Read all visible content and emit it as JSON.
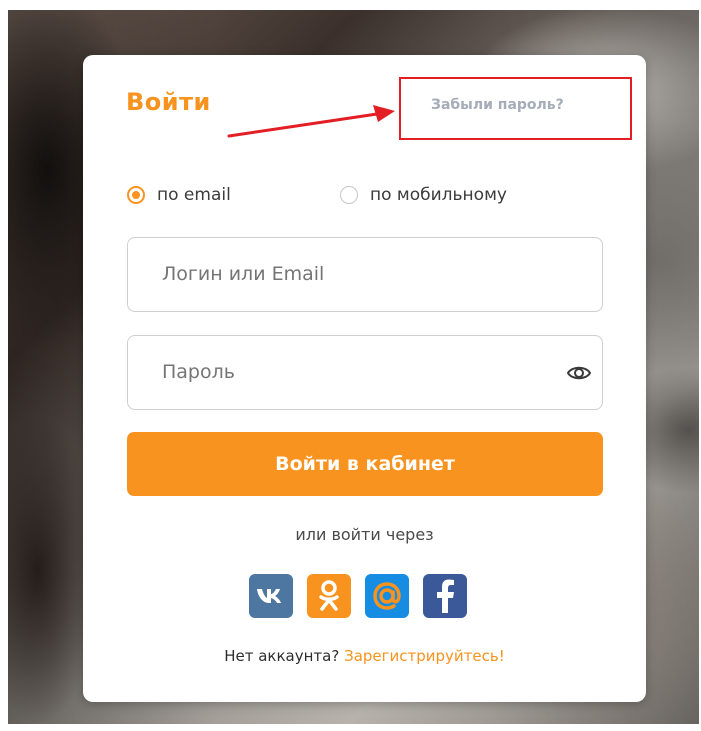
{
  "login": {
    "title": "Войти",
    "forgot_password": "Забыли пароль?",
    "method_email": "по email",
    "method_mobile": "по мобильному",
    "selected_method": "email",
    "login_placeholder": "Логин или Email",
    "password_placeholder": "Пароль",
    "submit_label": "Войти в кабинет",
    "social_caption": "или войти через",
    "no_account": "Нет аккаунта?",
    "register_link": "Зарегистрируйтесь!"
  },
  "social": [
    {
      "name": "vk-icon",
      "color": "#4d76a1"
    },
    {
      "name": "odnoklassniki-icon",
      "color": "#f7931e"
    },
    {
      "name": "mail-ru-icon",
      "color": "#168de2"
    },
    {
      "name": "facebook-icon",
      "color": "#3b5998"
    }
  ],
  "colors": {
    "accent": "#f7931e",
    "highlight_box": "#e31e24",
    "arrow": "#e31e24"
  }
}
